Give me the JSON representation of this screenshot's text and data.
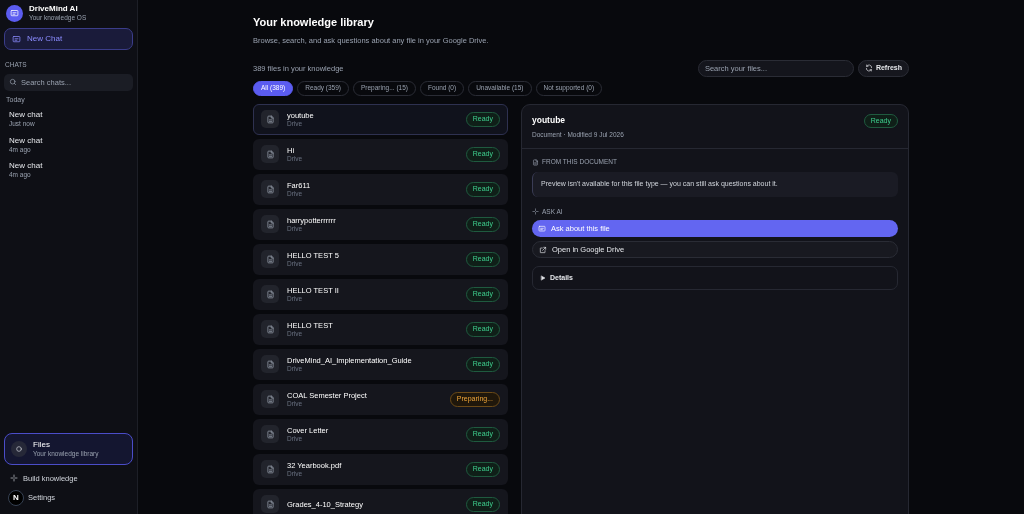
{
  "sidebar": {
    "app_name": "DriveMind AI",
    "app_tagline": "Your knowledge OS",
    "new_chat": "New Chat",
    "chats_heading": "CHATS",
    "search_placeholder": "Search chats...",
    "group_label": "Today",
    "chats": [
      {
        "title": "New chat",
        "time": "Just now"
      },
      {
        "title": "New chat",
        "time": "4m ago"
      },
      {
        "title": "New chat",
        "time": "4m ago"
      }
    ],
    "files_item": {
      "title": "Files",
      "subtitle": "Your knowledge library",
      "selected": true
    },
    "build_knowledge": "Build knowledge",
    "settings": "Settings",
    "dev_badge": "N"
  },
  "header": {
    "title": "Your knowledge library",
    "subtitle": "Browse, search, and ask questions about any file in your Google Drive.",
    "count": "389 files in your knowledge",
    "search_placeholder": "Search your files...",
    "refresh": "Refresh"
  },
  "filters": [
    {
      "label": "All (389)",
      "selected": true
    },
    {
      "label": "Ready (359)",
      "selected": false
    },
    {
      "label": "Preparing... (15)",
      "selected": false
    },
    {
      "label": "Found (0)",
      "selected": false
    },
    {
      "label": "Unavailable (15)",
      "selected": false
    },
    {
      "label": "Not supported (0)",
      "selected": false
    }
  ],
  "files": [
    {
      "name": "youtube",
      "source": "Drive",
      "kind": "ready",
      "status_label": "Ready",
      "selected": true
    },
    {
      "name": "Hi",
      "source": "Drive",
      "kind": "ready",
      "status_label": "Ready",
      "selected": false
    },
    {
      "name": "Far611",
      "source": "Drive",
      "kind": "ready",
      "status_label": "Ready",
      "selected": false
    },
    {
      "name": "harrypotterrrrrr",
      "source": "Drive",
      "kind": "ready",
      "status_label": "Ready",
      "selected": false
    },
    {
      "name": "HELLO TEST 5",
      "source": "Drive",
      "kind": "ready",
      "status_label": "Ready",
      "selected": false
    },
    {
      "name": "HELLO TEST II",
      "source": "Drive",
      "kind": "ready",
      "status_label": "Ready",
      "selected": false
    },
    {
      "name": "HELLO TEST",
      "source": "Drive",
      "kind": "ready",
      "status_label": "Ready",
      "selected": false
    },
    {
      "name": "DriveMind_AI_Implementation_Guide",
      "source": "Drive",
      "kind": "ready",
      "status_label": "Ready",
      "selected": false
    },
    {
      "name": "COAL Semester Project",
      "source": "Drive",
      "kind": "preparing",
      "status_label": "Preparing...",
      "selected": false
    },
    {
      "name": "Cover Letter",
      "source": "Drive",
      "kind": "ready",
      "status_label": "Ready",
      "selected": false
    },
    {
      "name": "32 Yearbook.pdf",
      "source": "Drive",
      "kind": "ready",
      "status_label": "Ready",
      "selected": false
    },
    {
      "name": "Grades_4-10_Strategy",
      "kind": "ready",
      "status_label": "Ready",
      "selected": false
    }
  ],
  "detail": {
    "title": "youtube",
    "meta": "Document · Modified 9 Jul 2026",
    "kind": "ready",
    "status_label": "Ready",
    "from_heading": "FROM THIS DOCUMENT",
    "preview_note": "Preview isn't available for this file type — you can still ask questions about it.",
    "ask_heading": "ASK AI",
    "ask_button": "Ask about this file",
    "open_button": "Open in Google Drive",
    "details": "Details"
  }
}
